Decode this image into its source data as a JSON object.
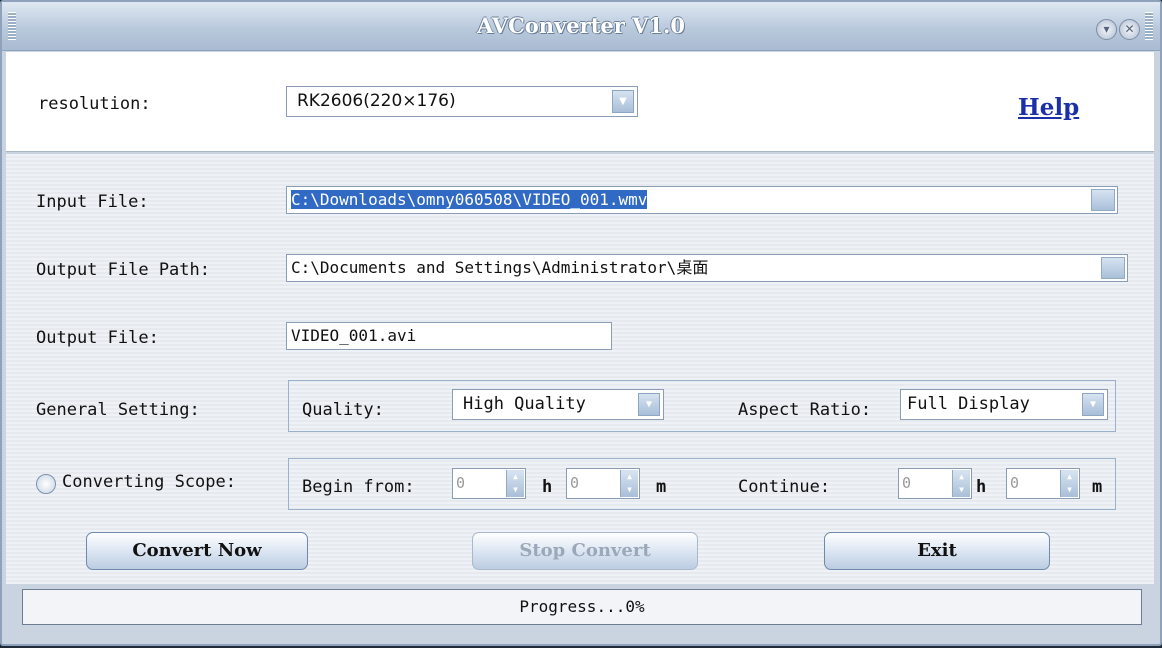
{
  "window": {
    "title": "AVConverter V1.0"
  },
  "top": {
    "resolution_label": "resolution:",
    "resolution_value": "RK2606(220×176)",
    "help_label": "Help"
  },
  "files": {
    "input_label": "Input File:",
    "input_value": "C:\\Downloads\\omny060508\\VIDEO_001.wmv",
    "output_path_label": "Output File Path:",
    "output_path_value": "C:\\Documents and Settings\\Administrator\\桌面",
    "output_file_label": "Output File:",
    "output_file_value": "VIDEO_001.avi"
  },
  "general": {
    "label": "General Setting:",
    "quality_label": "Quality:",
    "quality_value": "High Quality",
    "aspect_label": "Aspect Ratio:",
    "aspect_value": "Full Display"
  },
  "scope": {
    "label": "Converting Scope:",
    "checked": false,
    "begin_label": "Begin from:",
    "begin_h": "0",
    "begin_m": "0",
    "continue_label": "Continue:",
    "continue_h": "0",
    "continue_m": "0",
    "h_unit": "h",
    "m_unit": "m"
  },
  "buttons": {
    "convert": "Convert Now",
    "stop": "Stop Convert",
    "exit": "Exit"
  },
  "status": {
    "progress_text": "Progress...0%",
    "progress_value": 0
  },
  "icons": {
    "dropdown": "chevron-down-icon",
    "minimize": "minimize-icon",
    "close": "close-icon"
  }
}
